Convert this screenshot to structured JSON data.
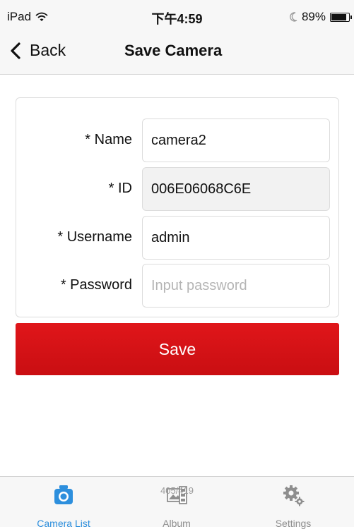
{
  "status_bar": {
    "device": "iPad",
    "time": "下午4:59",
    "battery": "89%",
    "battery_level": 0.89
  },
  "nav": {
    "back_label": "Back",
    "title": "Save Camera"
  },
  "form": {
    "fields": [
      {
        "label": "* Name",
        "value": "camera2",
        "placeholder": ""
      },
      {
        "label": "* ID",
        "value": "006E06068C6E",
        "placeholder": ""
      },
      {
        "label": "* Username",
        "value": "admin",
        "placeholder": ""
      },
      {
        "label": "* Password",
        "value": "",
        "placeholder": "Input password"
      }
    ]
  },
  "save_label": "Save",
  "tabs": [
    {
      "label": "Camera List",
      "icon": "camera-icon",
      "active": true
    },
    {
      "label": "Album",
      "icon": "album-icon",
      "active": false
    },
    {
      "label": "Settings",
      "icon": "gear-icon",
      "active": false
    }
  ],
  "watermark": "405/419",
  "colors": {
    "accent": "#2d8fdd",
    "save_button": "#d51216"
  }
}
